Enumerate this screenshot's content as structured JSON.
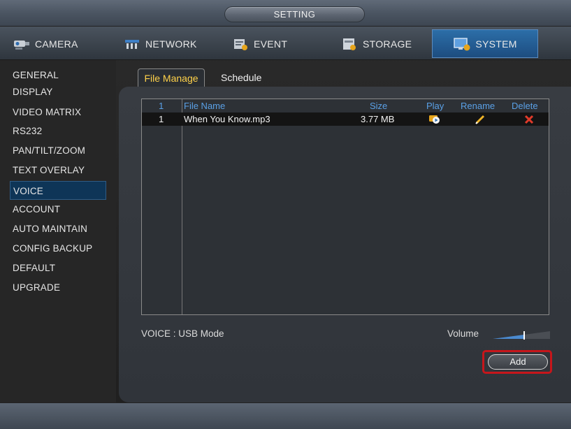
{
  "window": {
    "title": "SETTING"
  },
  "tabs": [
    {
      "label": "CAMERA",
      "icon": "camera-icon"
    },
    {
      "label": "NETWORK",
      "icon": "network-icon"
    },
    {
      "label": "EVENT",
      "icon": "event-icon"
    },
    {
      "label": "STORAGE",
      "icon": "storage-icon"
    },
    {
      "label": "SYSTEM",
      "icon": "system-icon",
      "active": true
    }
  ],
  "sidebar": {
    "items": [
      {
        "label": "GENERAL"
      },
      {
        "label": "DISPLAY"
      },
      {
        "label": "VIDEO MATRIX"
      },
      {
        "label": "RS232"
      },
      {
        "label": "PAN/TILT/ZOOM"
      },
      {
        "label": "TEXT OVERLAY"
      },
      {
        "label": "VOICE",
        "active": true
      },
      {
        "label": "ACCOUNT"
      },
      {
        "label": "AUTO MAINTAIN"
      },
      {
        "label": "CONFIG BACKUP"
      },
      {
        "label": "DEFAULT"
      },
      {
        "label": "UPGRADE"
      }
    ]
  },
  "subtabs": [
    {
      "label": "File Manage",
      "active": true
    },
    {
      "label": "Schedule"
    }
  ],
  "table": {
    "header": {
      "index": "1",
      "name": "File Name",
      "size": "Size",
      "play": "Play",
      "rename": "Rename",
      "delete": "Delete"
    },
    "rows": [
      {
        "index": "1",
        "name": "When You Know.mp3",
        "size": "3.77 MB"
      }
    ]
  },
  "footer": {
    "mode_text": "VOICE : USB Mode",
    "volume_label": "Volume",
    "volume_level": 0.55,
    "add_label": "Add"
  },
  "colors": {
    "accent_blue": "#2c6ea8",
    "header_text": "#5aa0e6",
    "active_subtab": "#ffd24a",
    "highlight_red": "#c6161b"
  }
}
